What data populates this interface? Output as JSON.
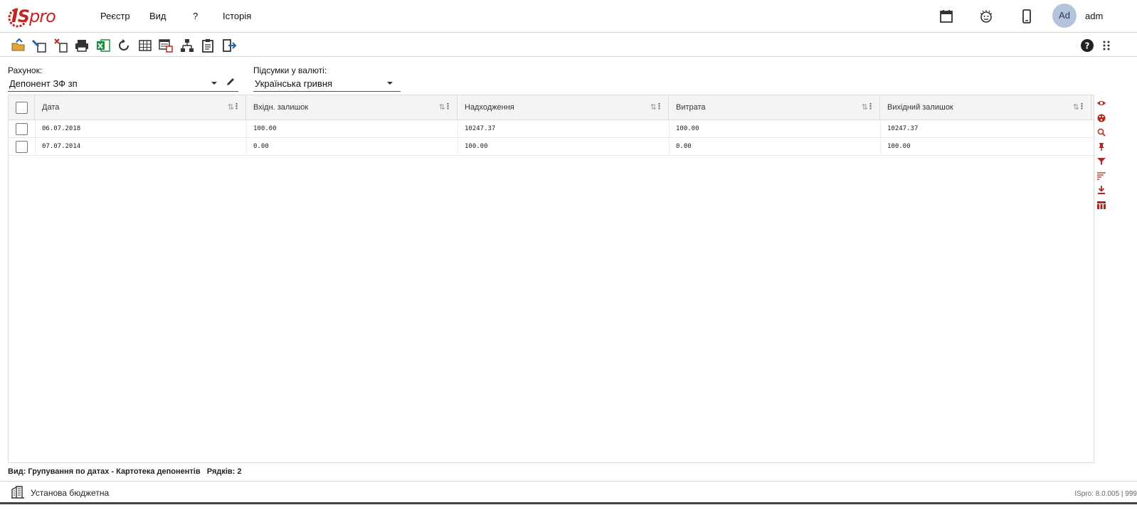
{
  "menu": [
    "Реєстр",
    "Вид",
    "?",
    "Історія"
  ],
  "user": {
    "initials": "Ad",
    "name": "adm"
  },
  "filters": {
    "account_label": "Рахунок:",
    "account_value": "Депонент ЗФ зп",
    "currency_label": "Підсумки у валюті:",
    "currency_value": "Українська гривня"
  },
  "table": {
    "columns": [
      "Дата",
      "Вхідн. залишок",
      "Надходження",
      "Витрата",
      "Вихідний залишок"
    ],
    "rows": [
      [
        "06.07.2018",
        "100.00",
        "10247.37",
        "100.00",
        "10247.37"
      ],
      [
        "07.07.2014",
        "0.00",
        "100.00",
        "0.00",
        "100.00"
      ]
    ]
  },
  "status": "Вид: Групування по датах - Картотека депонентів   Рядків: 2",
  "footer": {
    "org": "Установа бюджетна",
    "version": "ISpro: 8.0.005 | 999"
  },
  "colors": {
    "accent": "#c0261f",
    "icon_blue": "#1f5fa8",
    "icon_green": "#1e8a3c"
  }
}
